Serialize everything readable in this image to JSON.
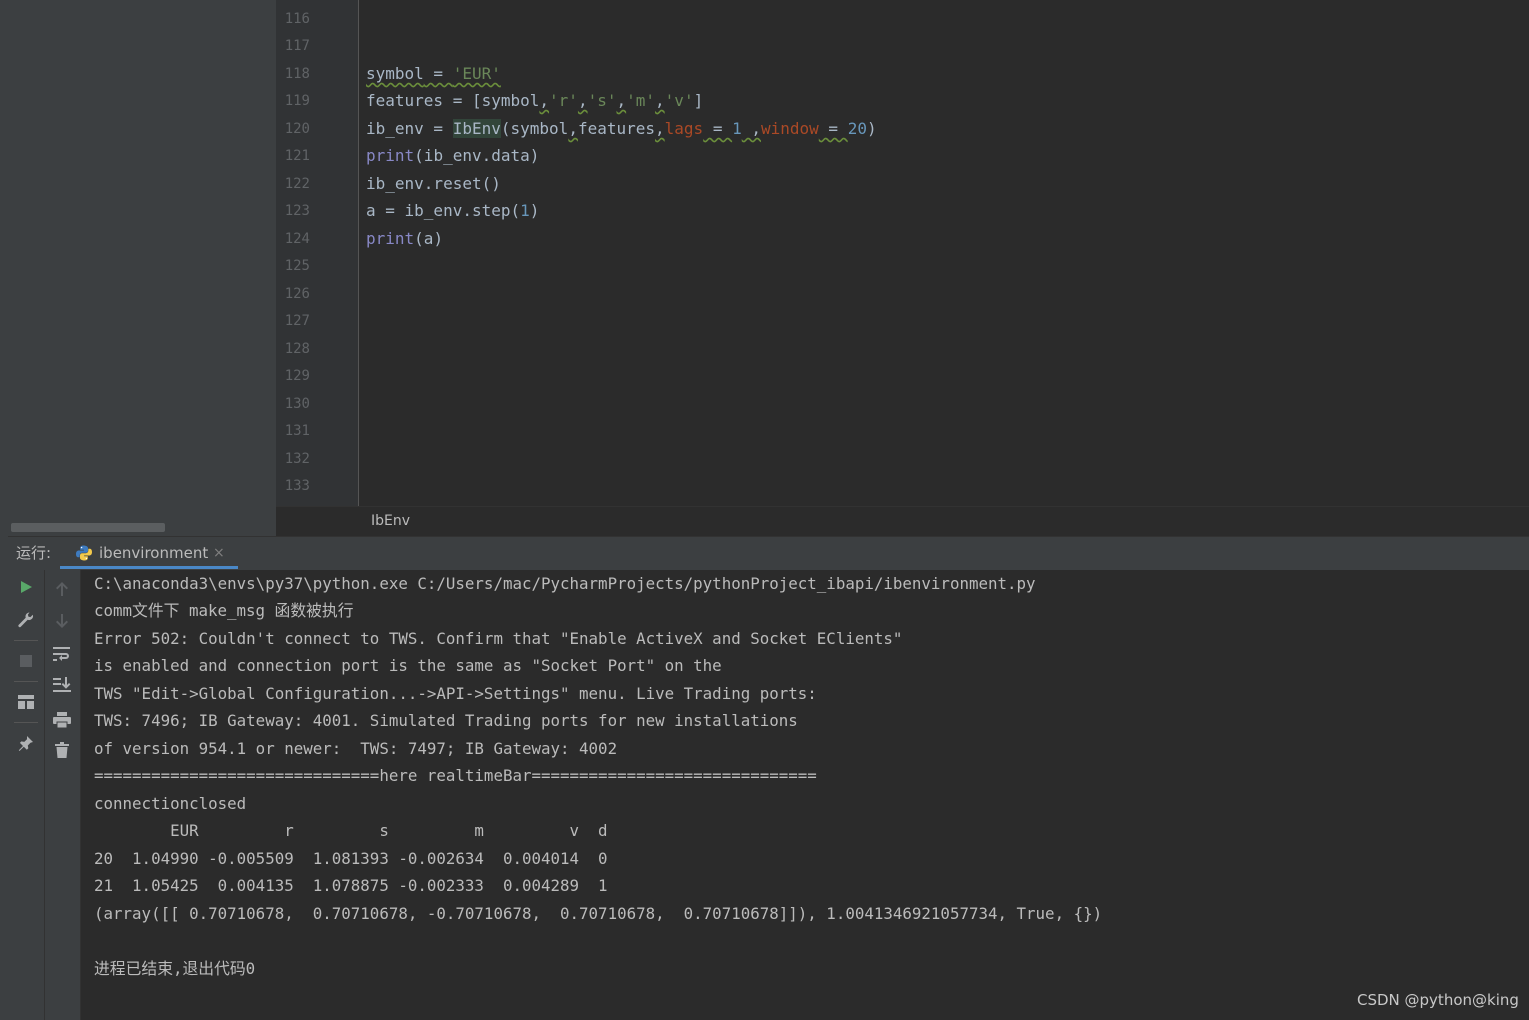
{
  "editor": {
    "line_numbers": [
      "116",
      "117",
      "118",
      "119",
      "120",
      "121",
      "122",
      "123",
      "124",
      "125",
      "126",
      "127",
      "128",
      "129",
      "130",
      "131",
      "132",
      "133"
    ],
    "code": {
      "l118": {
        "a": "symbol",
        "b": " = ",
        "c": "'EUR'"
      },
      "l119": {
        "a": "features = [symbol",
        "b": ",",
        "c": "'r'",
        "d": ",",
        "e": "'s'",
        "f": ",",
        "g": "'m'",
        "h": ",",
        "i": "'v'",
        "j": "]"
      },
      "l120": {
        "a": "ib_env = ",
        "b": "IbEnv",
        "c": "(symbol",
        "d": ",",
        "e": "features",
        "f": ",",
        "g": "lags",
        "h": " = ",
        "i": "1",
        "j": " ,",
        "k": "window",
        "l": " = ",
        "m": "20",
        "n": ")"
      },
      "l121": {
        "a": "print",
        "b": "(ib_env.data)"
      },
      "l122": {
        "a": "ib_env.reset()"
      },
      "l123": {
        "a": "a = ib_env.step(",
        "b": "1",
        "c": ")"
      },
      "l124": {
        "a": "print",
        "b": "(a)"
      }
    },
    "breadcrumb": "IbEnv"
  },
  "run_panel": {
    "label": "运行:",
    "tab_name": "ibenvironment",
    "tab_close": "×",
    "output_lines": [
      "C:\\anaconda3\\envs\\py37\\python.exe C:/Users/mac/PycharmProjects/pythonProject_ibapi/ibenvironment.py",
      "comm文件下 make_msg 函数被执行",
      "Error 502: Couldn't connect to TWS. Confirm that \"Enable ActiveX and Socket EClients\"",
      "is enabled and connection port is the same as \"Socket Port\" on the",
      "TWS \"Edit->Global Configuration...->API->Settings\" menu. Live Trading ports:",
      "TWS: 7496; IB Gateway: 4001. Simulated Trading ports for new installations",
      "of version 954.1 or newer:  TWS: 7497; IB Gateway: 4002",
      "==============================here realtimeBar==============================",
      "connectionclosed",
      "        EUR         r         s         m         v  d",
      "20  1.04990 -0.005509  1.081393 -0.002634  0.004014  0",
      "21  1.05425  0.004135  1.078875 -0.002333  0.004289  1",
      "(array([[ 0.70710678,  0.70710678, -0.70710678,  0.70710678,  0.70710678]]), 1.0041346921057734, True, {})",
      "",
      "进程已结束,退出代码0"
    ]
  },
  "watermark": "CSDN @python@king",
  "colors": {
    "background": "#2b2b2b",
    "panel": "#3c3f41",
    "run_green": "#59a869",
    "accent_blue": "#4a88c7"
  }
}
